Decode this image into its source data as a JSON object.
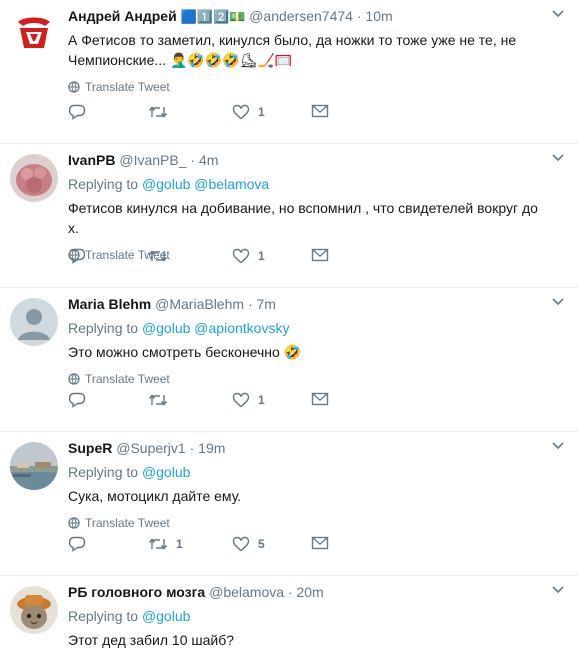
{
  "tweets": [
    {
      "name": "Андрей Андрей",
      "badge": "🟦1️⃣2️⃣💵",
      "handle": "@andersen7474",
      "dot": "·",
      "time": "10m",
      "replying_label": "",
      "mentions": [],
      "text": "А Фетисов то заметил, кинулся было, да ножки то тоже уже не те, не Чемпионские... 🤦‍♂️🤣🤣🤣⛸🏒🥅",
      "translate": "Translate Tweet",
      "reply_count": "",
      "retweet_count": "",
      "like_count": "1",
      "avatar": "red-logo-avatar"
    },
    {
      "name": "IvanPB",
      "badge": "",
      "handle": "@IvanPB_",
      "dot": "·",
      "time": "4m",
      "replying_label": "Replying to",
      "mentions": [
        "@golub",
        "@belamova"
      ],
      "text": "Фетисов кинулся на добивание, но вспомнил , что свидетелей вокруг до х.",
      "translate": "Translate Tweet",
      "reply_count": "",
      "retweet_count": "",
      "like_count": "1",
      "avatar": "pink-photo-avatar"
    },
    {
      "name": "Maria Blehm",
      "badge": "",
      "handle": "@MariaBlehm",
      "dot": "·",
      "time": "7m",
      "replying_label": "Replying to",
      "mentions": [
        "@golub",
        "@apiontkovsky"
      ],
      "text": "Это можно смотреть бесконечно 🤣",
      "translate": "Translate Tweet",
      "reply_count": "",
      "retweet_count": "",
      "like_count": "1",
      "avatar": "default-avatar"
    },
    {
      "name": "SupeR",
      "badge": "",
      "handle": "@Superjv1",
      "dot": "·",
      "time": "19m",
      "replying_label": "Replying to",
      "mentions": [
        "@golub"
      ],
      "text": "Сука, мотоцикл дайте ему.",
      "translate": "Translate Tweet",
      "reply_count": "",
      "retweet_count": "1",
      "like_count": "5",
      "avatar": "harbor-photo-avatar"
    },
    {
      "name": "РБ головного мозга",
      "badge": "",
      "handle": "@belamova",
      "dot": "·",
      "time": "20m",
      "replying_label": "Replying to",
      "mentions": [
        "@golub"
      ],
      "text": "Этот дед забил 10 шайб?",
      "translate": "",
      "reply_count": "",
      "retweet_count": "",
      "like_count": "",
      "avatar": "cat-hat-avatar"
    }
  ],
  "colors": {
    "link": "#1da1f2",
    "muted": "#657786",
    "text": "#14171a",
    "divider": "#e6ecf0"
  },
  "icons": {
    "reply": "reply-icon",
    "retweet": "retweet-icon",
    "like": "heart-icon",
    "dm": "envelope-icon",
    "menu": "chevron-down-icon",
    "translate": "globe-icon"
  }
}
